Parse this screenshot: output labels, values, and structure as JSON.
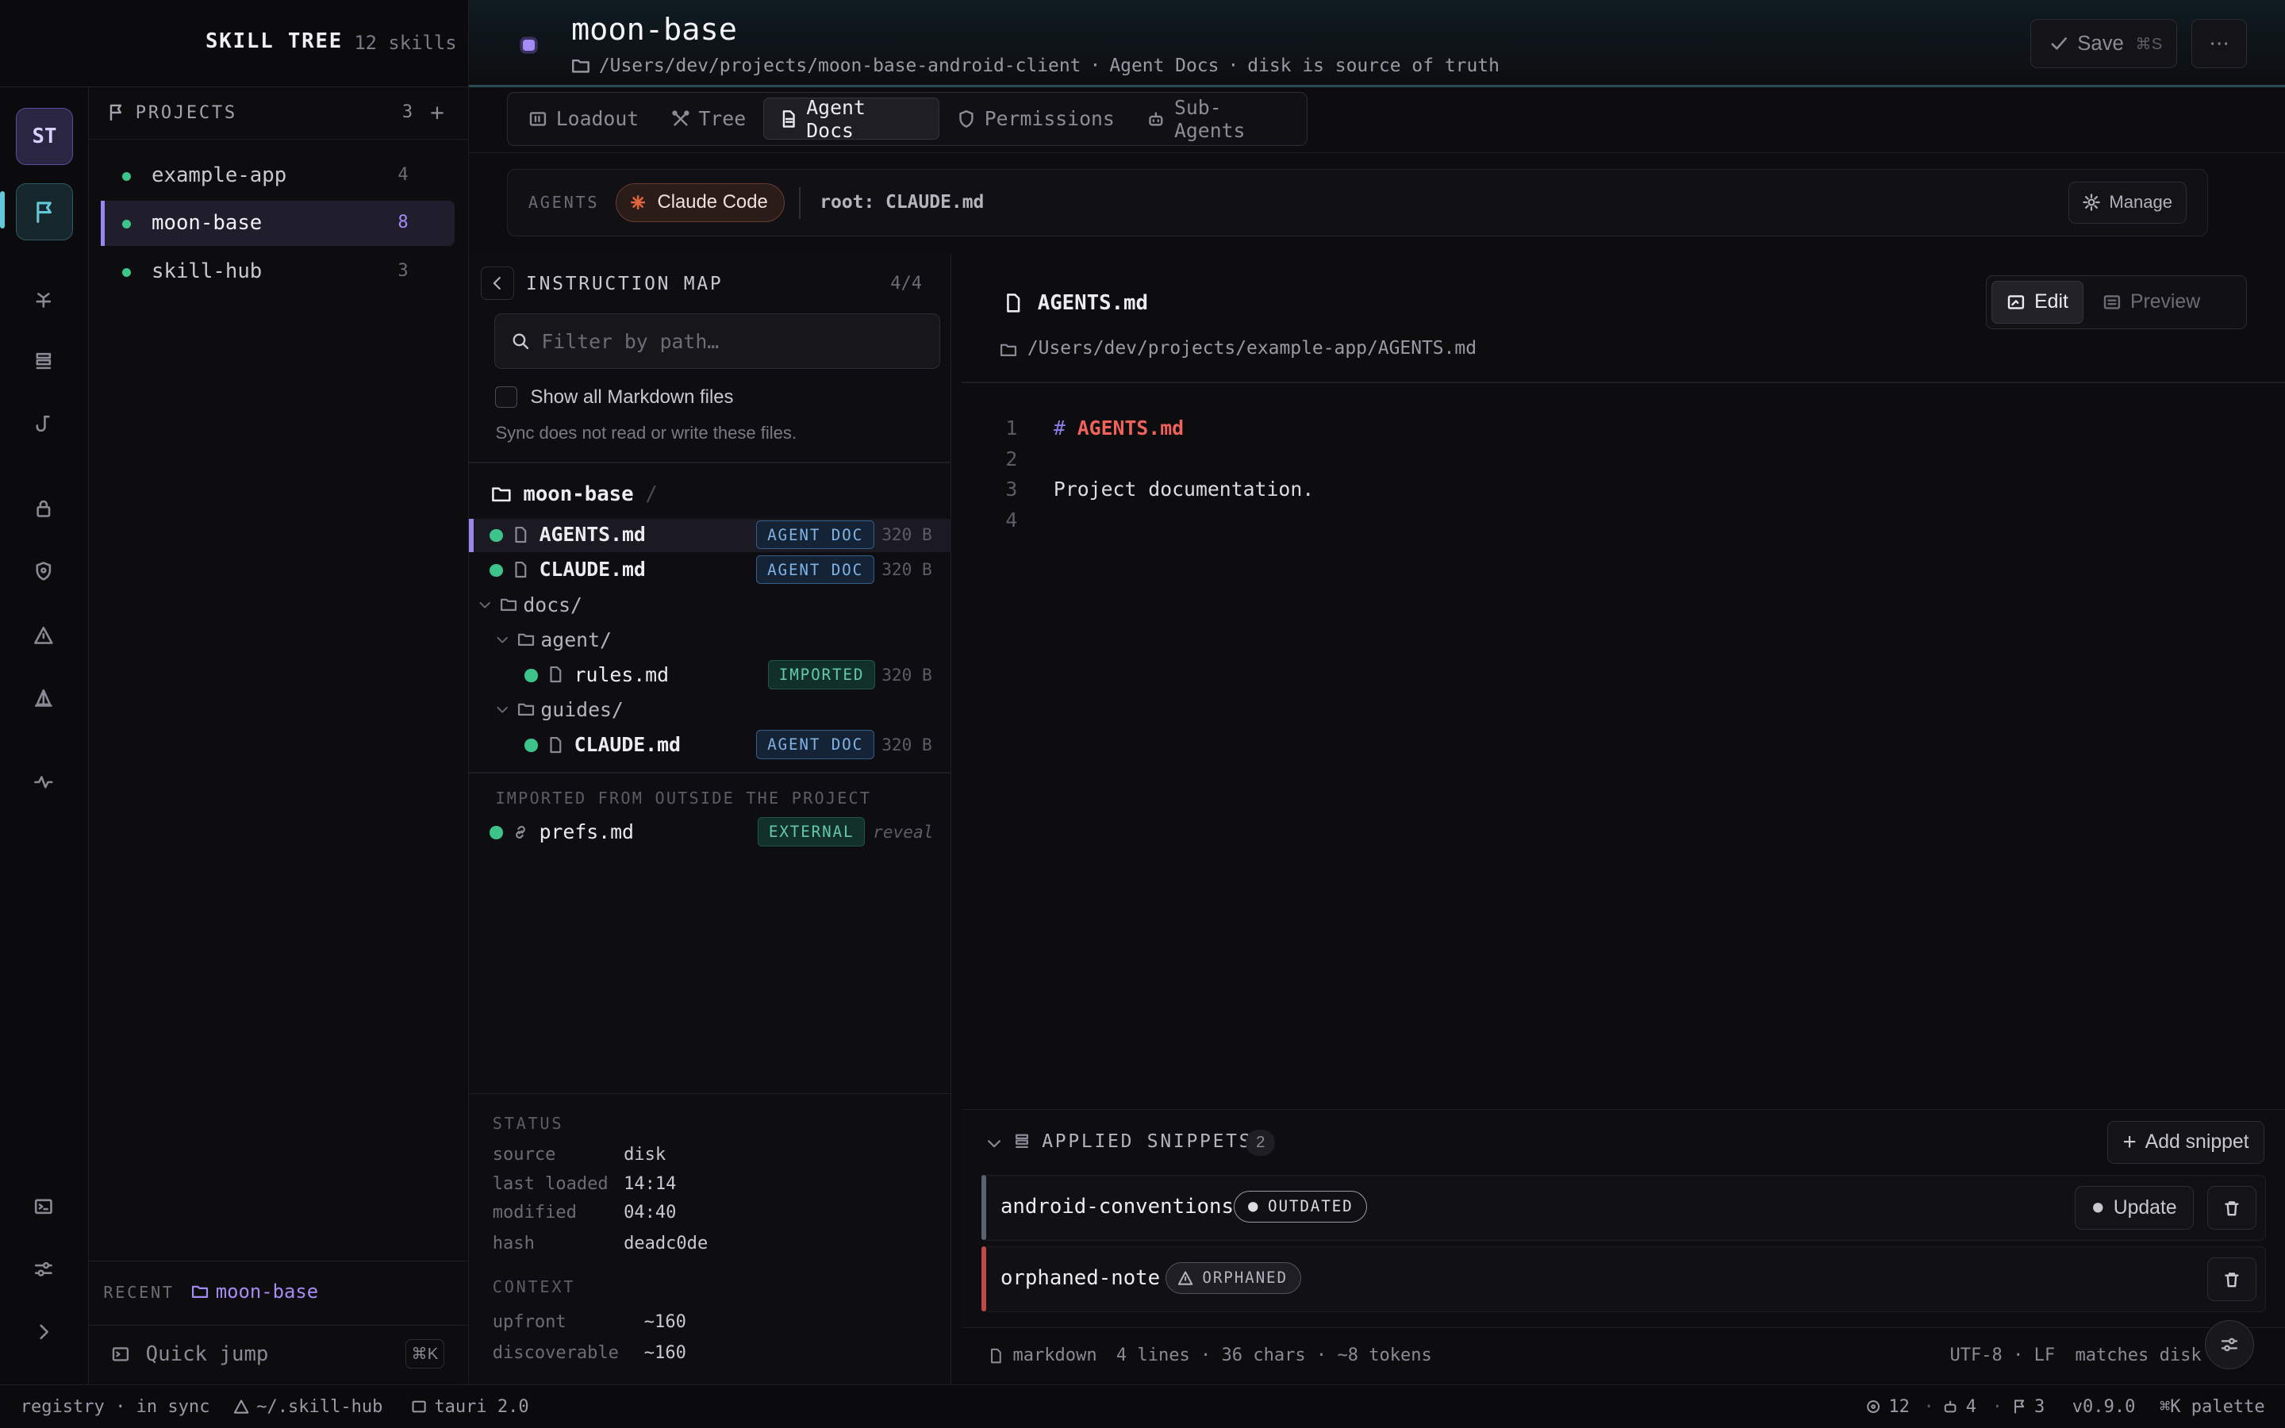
{
  "brand": {
    "name": "SKILL TREE",
    "count": "12 skills"
  },
  "header": {
    "title": "moon-base",
    "path": "/Users/dev/projects/moon-base-android-client",
    "section": "Agent Docs",
    "note": "disk is source of truth",
    "save_label": "Save",
    "save_shortcut": "⌘S",
    "more_label": "⋯"
  },
  "rail": {
    "avatar": "ST"
  },
  "projects": {
    "label": "PROJECTS",
    "count": "3",
    "items": [
      {
        "name": "example-app",
        "count": "4"
      },
      {
        "name": "moon-base",
        "count": "8"
      },
      {
        "name": "skill-hub",
        "count": "3"
      }
    ],
    "recent_label": "RECENT",
    "recent_value": "moon-base",
    "quick_jump": "Quick jump",
    "quick_jump_key": "⌘K"
  },
  "tabs": [
    {
      "label": "Loadout"
    },
    {
      "label": "Tree"
    },
    {
      "label": "Agent Docs"
    },
    {
      "label": "Permissions"
    },
    {
      "label": "Sub-Agents"
    }
  ],
  "agents": {
    "label": "AGENTS",
    "chip": "Claude Code",
    "root": "root: CLAUDE.md",
    "manage": "Manage",
    "chip_color": "#e0643c"
  },
  "map": {
    "title": "INSTRUCTION MAP",
    "count": "4/4",
    "filter_placeholder": "Filter by path…",
    "show_all": "Show all Markdown files",
    "note": "Sync does not read or write these files.",
    "root": "moon-base",
    "root_sep": "/",
    "files": [
      {
        "name": "AGENTS.md",
        "badge": "AGENT DOC",
        "size": "320 B"
      },
      {
        "name": "CLAUDE.md",
        "badge": "AGENT DOC",
        "size": "320 B"
      },
      {
        "name": "docs/"
      },
      {
        "name": "agent/"
      },
      {
        "name": "rules.md",
        "badge": "IMPORTED",
        "size": "320 B"
      },
      {
        "name": "guides/"
      },
      {
        "name": "CLAUDE.md",
        "badge": "AGENT DOC",
        "size": "320 B"
      }
    ],
    "imported_label": "IMPORTED FROM OUTSIDE THE PROJECT",
    "external": {
      "name": "prefs.md",
      "badge": "EXTERNAL",
      "action": "reveal"
    },
    "status": {
      "title": "STATUS",
      "rows": [
        {
          "k": "source",
          "v": "disk"
        },
        {
          "k": "last loaded",
          "v": "14:14"
        },
        {
          "k": "modified",
          "v": "04:40"
        },
        {
          "k": "hash",
          "v": "deadc0de"
        }
      ],
      "context_title": "CONTEXT",
      "context": [
        {
          "k": "upfront",
          "v": "~160"
        },
        {
          "k": "discoverable",
          "v": "~160"
        }
      ]
    }
  },
  "editor": {
    "filename": "AGENTS.md",
    "filepath": "/Users/dev/projects/example-app/AGENTS.md",
    "edit": "Edit",
    "preview": "Preview",
    "lines": [
      {
        "n": "1",
        "hash": "#",
        "heading": "AGENTS.md",
        "text": ""
      },
      {
        "n": "2",
        "hash": "",
        "heading": "",
        "text": ""
      },
      {
        "n": "3",
        "hash": "",
        "heading": "",
        "text": "Project documentation."
      },
      {
        "n": "4",
        "hash": "",
        "heading": "",
        "text": ""
      }
    ]
  },
  "snippets": {
    "title": "APPLIED SNIPPETS",
    "count": "2",
    "add": "Add snippet",
    "items": [
      {
        "name": "android-conventions",
        "badge": "OUTDATED",
        "action": "Update"
      },
      {
        "name": "orphaned-note",
        "badge": "ORPHANED"
      }
    ]
  },
  "editor_status": {
    "lang": "markdown",
    "stats": "4 lines · 36 chars · ~8 tokens",
    "encoding": "UTF-8 · LF",
    "disk": "matches disk"
  },
  "footer": {
    "registry": "registry · in sync",
    "hub": "~/.skill-hub",
    "runtime": "tauri 2.0",
    "skills": "12",
    "agents": "4",
    "projects": "3",
    "version": "v0.9.0",
    "palette": "⌘K palette"
  }
}
